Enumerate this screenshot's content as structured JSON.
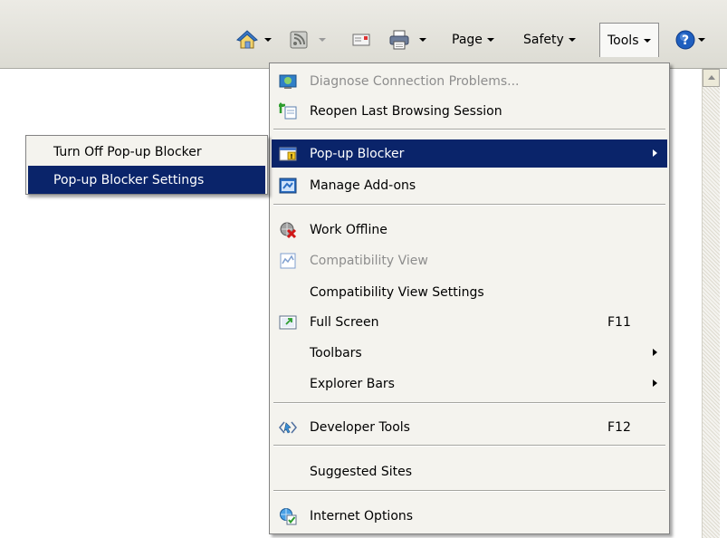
{
  "command_bar": {
    "icons": {
      "home": "home-icon",
      "feeds": "feeds-icon",
      "mail": "mail-icon",
      "print": "print-icon",
      "help": "help-icon"
    },
    "page_label": "Page",
    "safety_label": "Safety",
    "tools_label": "Tools"
  },
  "tools_menu": {
    "items": [
      {
        "label": "Diagnose Connection Problems...",
        "icon": "diagnose-connection-icon",
        "state": "disabled"
      },
      {
        "label": "Reopen Last Browsing Session",
        "icon": "reopen-session-icon",
        "state": "normal"
      },
      {
        "label": "Pop-up Blocker",
        "icon": "popup-blocker-icon",
        "state": "selected",
        "submenu": true
      },
      {
        "label": "Manage Add-ons",
        "icon": "manage-addons-icon",
        "state": "normal"
      },
      {
        "label": "Work Offline",
        "icon": "work-offline-icon",
        "state": "normal"
      },
      {
        "label": "Compatibility View",
        "icon": "compatibility-view-icon",
        "state": "disabled"
      },
      {
        "label": "Compatibility View Settings",
        "state": "normal"
      },
      {
        "label": "Full Screen",
        "icon": "full-screen-icon",
        "state": "normal",
        "shortcut": "F11"
      },
      {
        "label": "Toolbars",
        "state": "normal",
        "submenu": true
      },
      {
        "label": "Explorer Bars",
        "state": "normal",
        "submenu": true
      },
      {
        "label": "Developer Tools",
        "icon": "developer-tools-icon",
        "state": "normal",
        "shortcut": "F12"
      },
      {
        "label": "Suggested Sites",
        "state": "normal"
      },
      {
        "label": "Internet Options",
        "icon": "internet-options-icon",
        "state": "normal"
      }
    ]
  },
  "popup_submenu": {
    "items": [
      {
        "label": "Turn Off Pop-up Blocker",
        "state": "normal"
      },
      {
        "label": "Pop-up Blocker Settings",
        "state": "selected"
      }
    ]
  },
  "colors": {
    "selection": "#0a246a",
    "menu_background": "#f4f3ee",
    "disabled_text": "#8d8d8d"
  }
}
